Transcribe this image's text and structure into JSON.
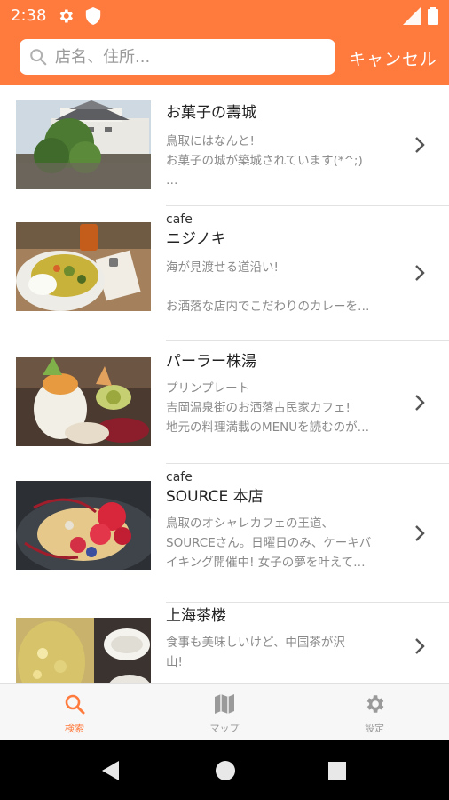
{
  "status_bar": {
    "time": "2:38",
    "icons": [
      "gear-icon",
      "shield-icon",
      "signal-icon",
      "battery-icon"
    ]
  },
  "search": {
    "placeholder": "店名、住所...",
    "value": "",
    "cancel_label": "キャンセル"
  },
  "colors": {
    "accent": "#ff7a3d",
    "nav_inactive": "#9a9a9a",
    "description_text": "#8a8a8a"
  },
  "list": {
    "items": [
      {
        "category": "",
        "title": "お菓子の壽城",
        "description": "鳥取にはなんと!\nお菓子の城が築城されています(*^;)\n…"
      },
      {
        "category": "cafe",
        "title": "ニジノキ",
        "description": "海が見渡せる道沿い!\n\nお洒落な店内でこだわりのカレーを…"
      },
      {
        "category": "",
        "title": "パーラー株湯",
        "description": "プリンプレート\n吉岡温泉街のお洒落古民家カフェ!\n地元の料理満載のMENUを読むのが…"
      },
      {
        "category": "cafe",
        "title": "SOURCE 本店",
        "description": "鳥取のオシャレカフェの王道、\nSOURCEさん。日曜日のみ、ケーキバ\nイキング開催中! 女子の夢を叶えて…"
      },
      {
        "category": "",
        "title": "上海茶楼",
        "description": "食事も美味しいけど、中国茶が沢\n山!"
      }
    ]
  },
  "bottom_nav": {
    "tabs": [
      {
        "label": "検索",
        "icon": "search-icon",
        "active": true
      },
      {
        "label": "マップ",
        "icon": "map-icon",
        "active": false
      },
      {
        "label": "設定",
        "icon": "gear-icon",
        "active": false
      }
    ]
  },
  "system_nav": {
    "buttons": [
      "back-icon",
      "home-icon",
      "recents-icon"
    ]
  }
}
